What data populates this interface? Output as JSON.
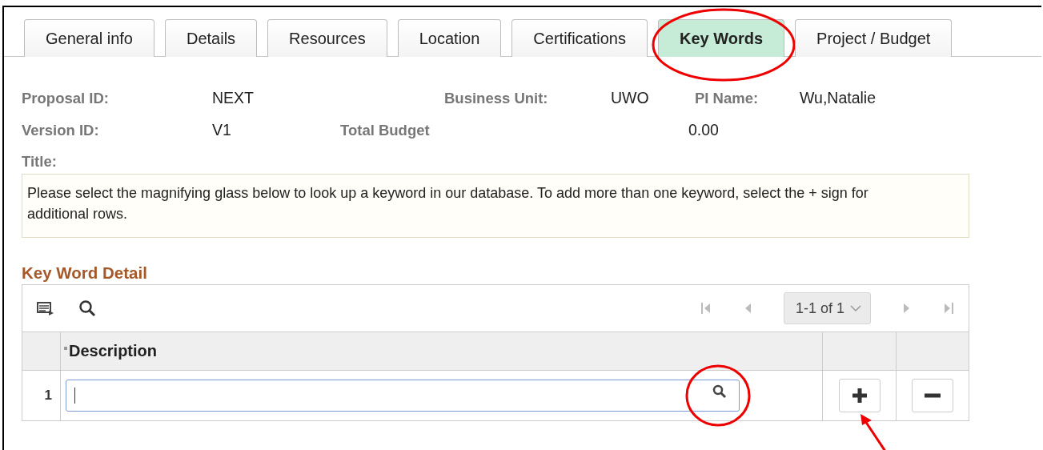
{
  "tabs": [
    {
      "label": "General info",
      "selected": false,
      "circled": false
    },
    {
      "label": "Details",
      "selected": false,
      "circled": false
    },
    {
      "label": "Resources",
      "selected": false,
      "circled": false
    },
    {
      "label": "Location",
      "selected": false,
      "circled": false
    },
    {
      "label": "Certifications",
      "selected": false,
      "circled": false
    },
    {
      "label": "Key Words",
      "selected": true,
      "circled": true
    },
    {
      "label": "Project / Budget",
      "selected": false,
      "circled": false
    }
  ],
  "header": {
    "proposal_id": {
      "label": "Proposal ID:",
      "value": "NEXT"
    },
    "business_unit": {
      "label": "Business Unit:",
      "value": "UWO"
    },
    "pi_name": {
      "label": "PI Name:",
      "value": "Wu,Natalie"
    },
    "version_id": {
      "label": "Version ID:",
      "value": "V1"
    },
    "total_budget": {
      "label": "Total Budget",
      "value": "0.00"
    },
    "title": {
      "label": "Title:"
    }
  },
  "instructions": "Please select the magnifying glass below to look up a keyword in our database. To add more than one keyword, select the + sign for additional rows.",
  "grid": {
    "title": "Key Word Detail",
    "pagination": "1-1 of 1",
    "columns": [
      {
        "label": "Description",
        "required": true
      }
    ],
    "rows": [
      {
        "number": "1",
        "lookup_circled": true,
        "add_arrowed": true
      }
    ]
  }
}
